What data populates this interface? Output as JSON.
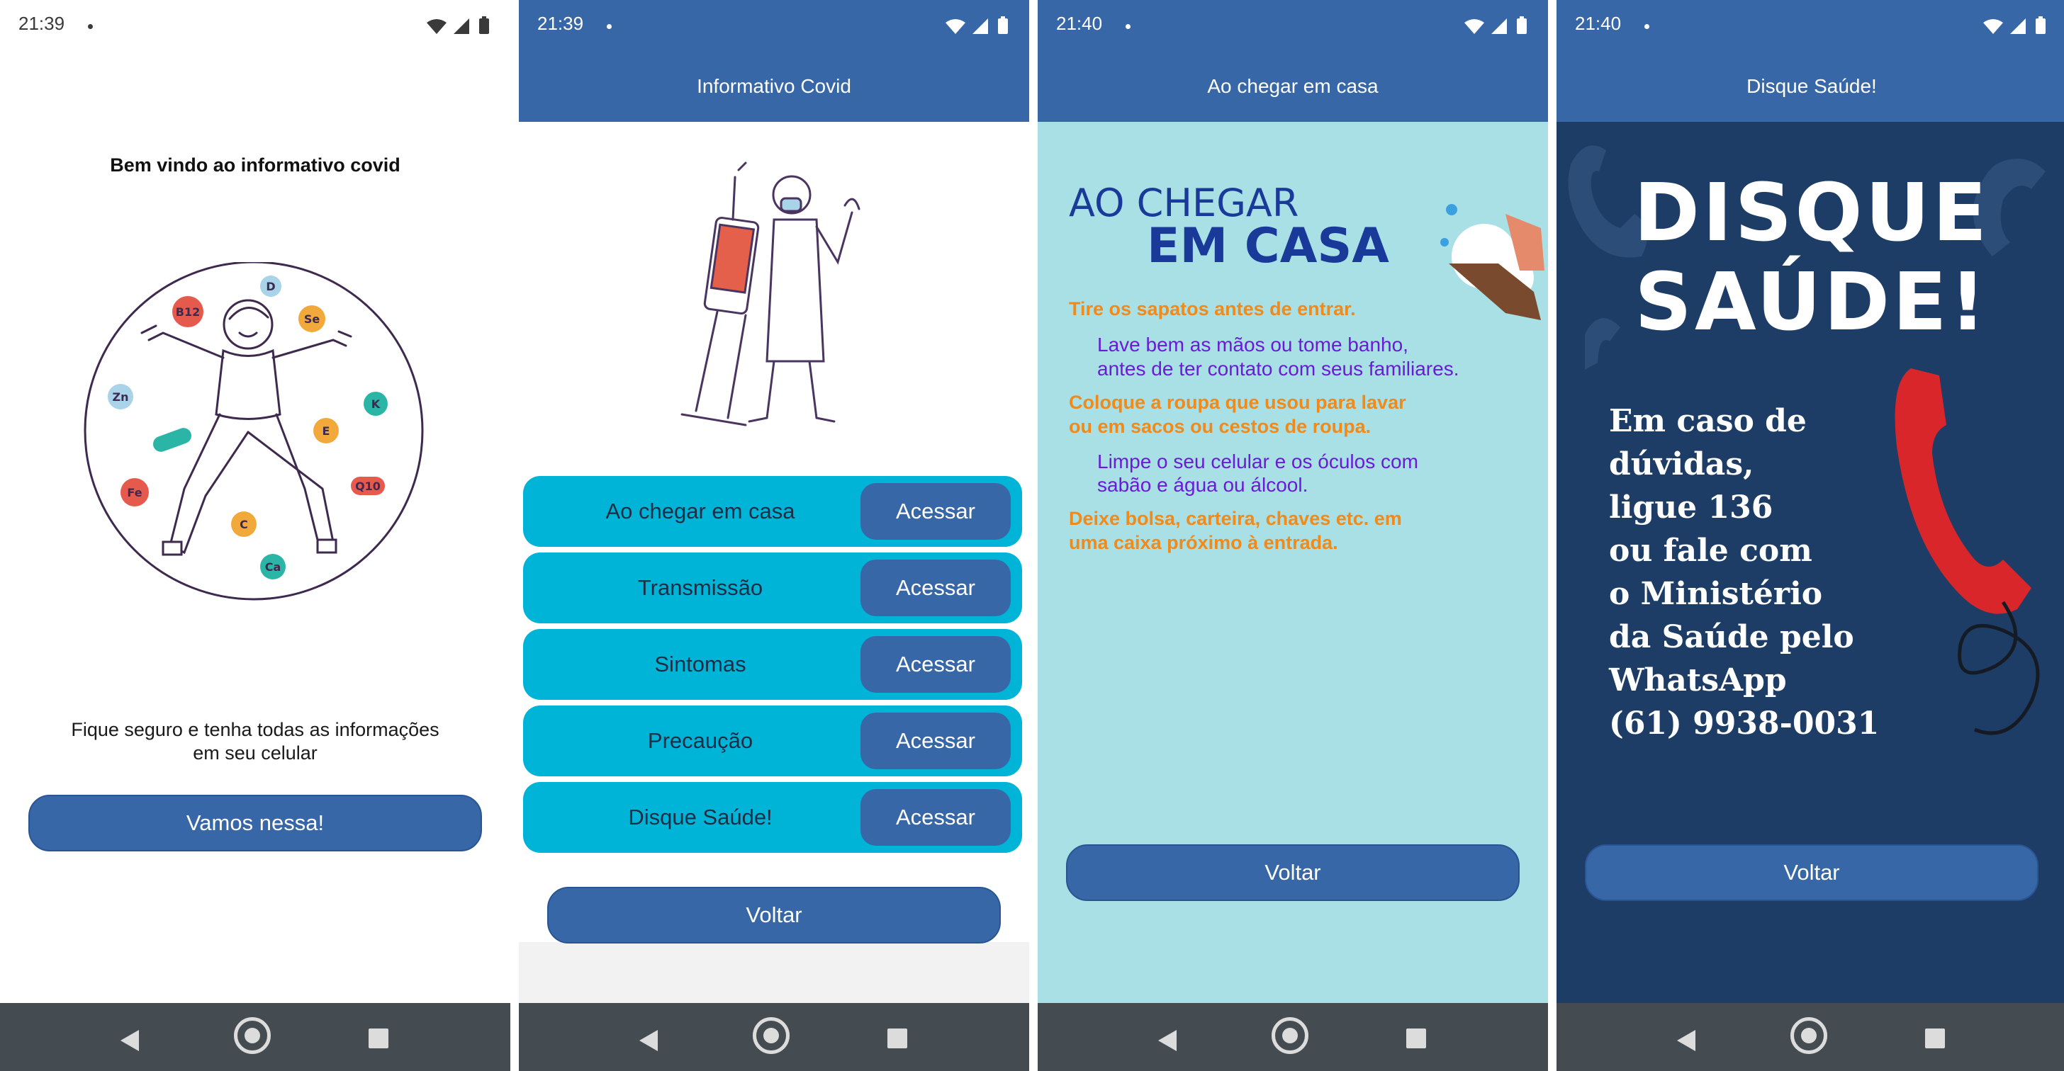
{
  "screen1": {
    "status": {
      "time": "21:39"
    },
    "heading": "Bem vindo ao informativo covid",
    "subtitle_line1": "Fique seguro e tenha todas as informações",
    "subtitle_line2": "em seu celular",
    "button": "Vamos nessa!",
    "vitamins": [
      "B12",
      "D",
      "Se",
      "Zn",
      "K",
      "E",
      "Fe",
      "C",
      "Q10",
      "Ca"
    ]
  },
  "screen2": {
    "status": {
      "time": "21:39"
    },
    "title": "Informativo Covid",
    "items": [
      {
        "label": "Ao chegar em casa",
        "action": "Acessar"
      },
      {
        "label": "Transmissão",
        "action": "Acessar"
      },
      {
        "label": "Sintomas",
        "action": "Acessar"
      },
      {
        "label": "Precaução",
        "action": "Acessar"
      },
      {
        "label": "Disque Saúde!",
        "action": "Acessar"
      }
    ],
    "back": "Voltar"
  },
  "screen3": {
    "status": {
      "time": "21:40"
    },
    "title": "Ao chegar em casa",
    "poster_title_1": "AO CHEGAR",
    "poster_title_2": "EM CASA",
    "tips": [
      {
        "l1": "Tire os sapatos antes de entrar.",
        "l2": ""
      },
      {
        "l1": "Lave bem as mãos ou tome banho,",
        "l2": "antes de ter contato com seus familiares."
      },
      {
        "l1": "Coloque a roupa que usou para lavar",
        "l2": "ou em sacos ou cestos de roupa."
      },
      {
        "l1": "Limpe o seu celular e os óculos com",
        "l2": "sabão e água ou álcool."
      },
      {
        "l1": "Deixe bolsa, carteira, chaves etc. em",
        "l2": "uma caixa próximo à entrada."
      }
    ],
    "back": "Voltar"
  },
  "screen4": {
    "status": {
      "time": "21:40"
    },
    "title": "Disque Saúde!",
    "poster_title_1": "DISQUE",
    "poster_title_2": "SAÚDE!",
    "body": [
      "Em caso de",
      "dúvidas,",
      "ligue 136",
      "ou fale com",
      "o Ministério",
      "da Saúde pelo",
      "WhatsApp",
      "(61) 9938-0031"
    ],
    "back": "Voltar"
  },
  "colors": {
    "primary": "#3767a7",
    "row": "#00b4d8",
    "navbar": "#444c52",
    "poster_bg": "#a9e0e6",
    "disque_bg": "#1d3d66",
    "orange": "#f08a1a",
    "purple": "#6a1bd8"
  }
}
